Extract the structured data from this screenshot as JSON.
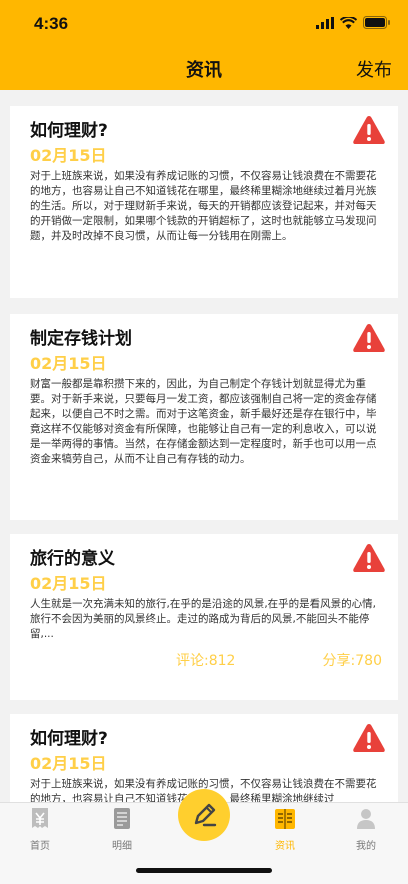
{
  "status": {
    "time": "4:36"
  },
  "nav": {
    "title": "资讯",
    "action": "发布"
  },
  "articles": [
    {
      "title": "如何理财?",
      "date": "02月15日",
      "body": "对于上班族来说，如果没有养成记账的习惯，不仅容易让钱浪费在不需要花的地方，也容易让自己不知道钱花在哪里，最终稀里糊涂地继续过着月光族的生活。所以，对于理财新手来说，每天的开销都应该登记起来，并对每天的开销做一定限制，如果哪个钱款的开销超标了，这时也就能够立马发现问题，并及时改掉不良习惯，从而让每一分钱用在刚需上。"
    },
    {
      "title": "制定存钱计划",
      "date": "02月15日",
      "body": "财富一般都是靠积攒下来的，因此，为自己制定个存钱计划就显得尤为重要。对于新手来说，只要每月一发工资，都应该强制自己将一定的资金存储起来，以便自己不时之需。而对于这笔资金，新手最好还是存在银行中，毕竟这样不仅能够对资金有所保障，也能够让自己有一定的利息收入，可以说是一举两得的事情。当然，在存储金额达到一定程度时，新手也可以用一点资金来犒劳自己，从而不让自己有存钱的动力。"
    },
    {
      "title": "旅行的意义",
      "date": "02月15日",
      "body": "人生就是一次充满未知的旅行,在乎的是沿途的风景,在乎的是看风景的心情,旅行不会因为美丽的风景终止。走过的路成为背后的风景,不能回头不能停留,...",
      "comments": "评论:812",
      "shares": "分享:780"
    },
    {
      "title": "如何理财?",
      "date": "02月15日",
      "body": "对于上班族来说，如果没有养成记账的习惯，不仅容易让钱浪费在不需要花的地方，也容易让自己不知道钱花在哪里，最终稀里糊涂地继续过"
    }
  ],
  "tabs": [
    {
      "label": "首页",
      "icon": "yen-doc-icon"
    },
    {
      "label": "明细",
      "icon": "list-doc-icon"
    },
    {
      "label": "资讯",
      "icon": "book-icon",
      "active": true
    },
    {
      "label": "我的",
      "icon": "person-icon"
    }
  ],
  "colors": {
    "accent": "#ffb700",
    "date": "#ffcf48",
    "warn": "#e8413a"
  }
}
